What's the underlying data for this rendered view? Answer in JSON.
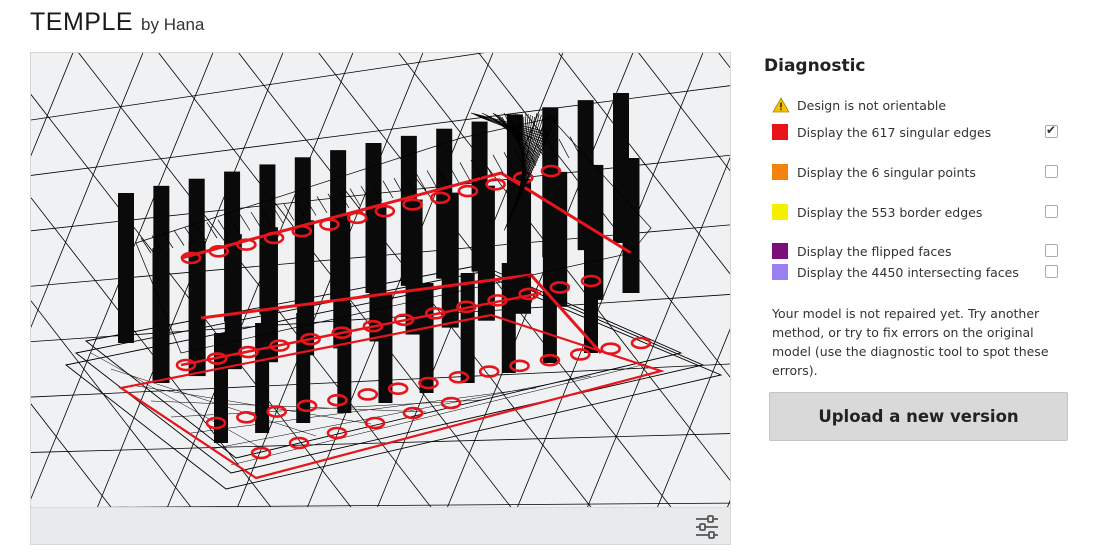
{
  "header": {
    "title": "TEMPLE",
    "byline": "by Hana"
  },
  "viewer": {
    "settings_icon": "sliders-icon"
  },
  "diagnostic": {
    "heading": "Diagnostic",
    "warning": {
      "icon": "warning-icon",
      "text": "Design is not orientable"
    },
    "options": [
      {
        "label": "Display the 617 singular edges",
        "color": "#e8141c",
        "checked": true
      },
      {
        "label": "Display the 6 singular points",
        "color": "#f5820f",
        "checked": false
      },
      {
        "label": "Display the 553 border edges",
        "color": "#f7ef00",
        "checked": false
      },
      {
        "label": "Display the flipped faces",
        "color": "#7a0f7c",
        "checked": false
      },
      {
        "label": "Display the 4450 intersecting faces",
        "color": "#9b7ff0",
        "checked": false
      }
    ],
    "note": "Your model is not repaired yet. Try another method, or try to fix errors on the original model (use the diagnostic tool to spot these errors).",
    "upload_label": "Upload a new version"
  }
}
